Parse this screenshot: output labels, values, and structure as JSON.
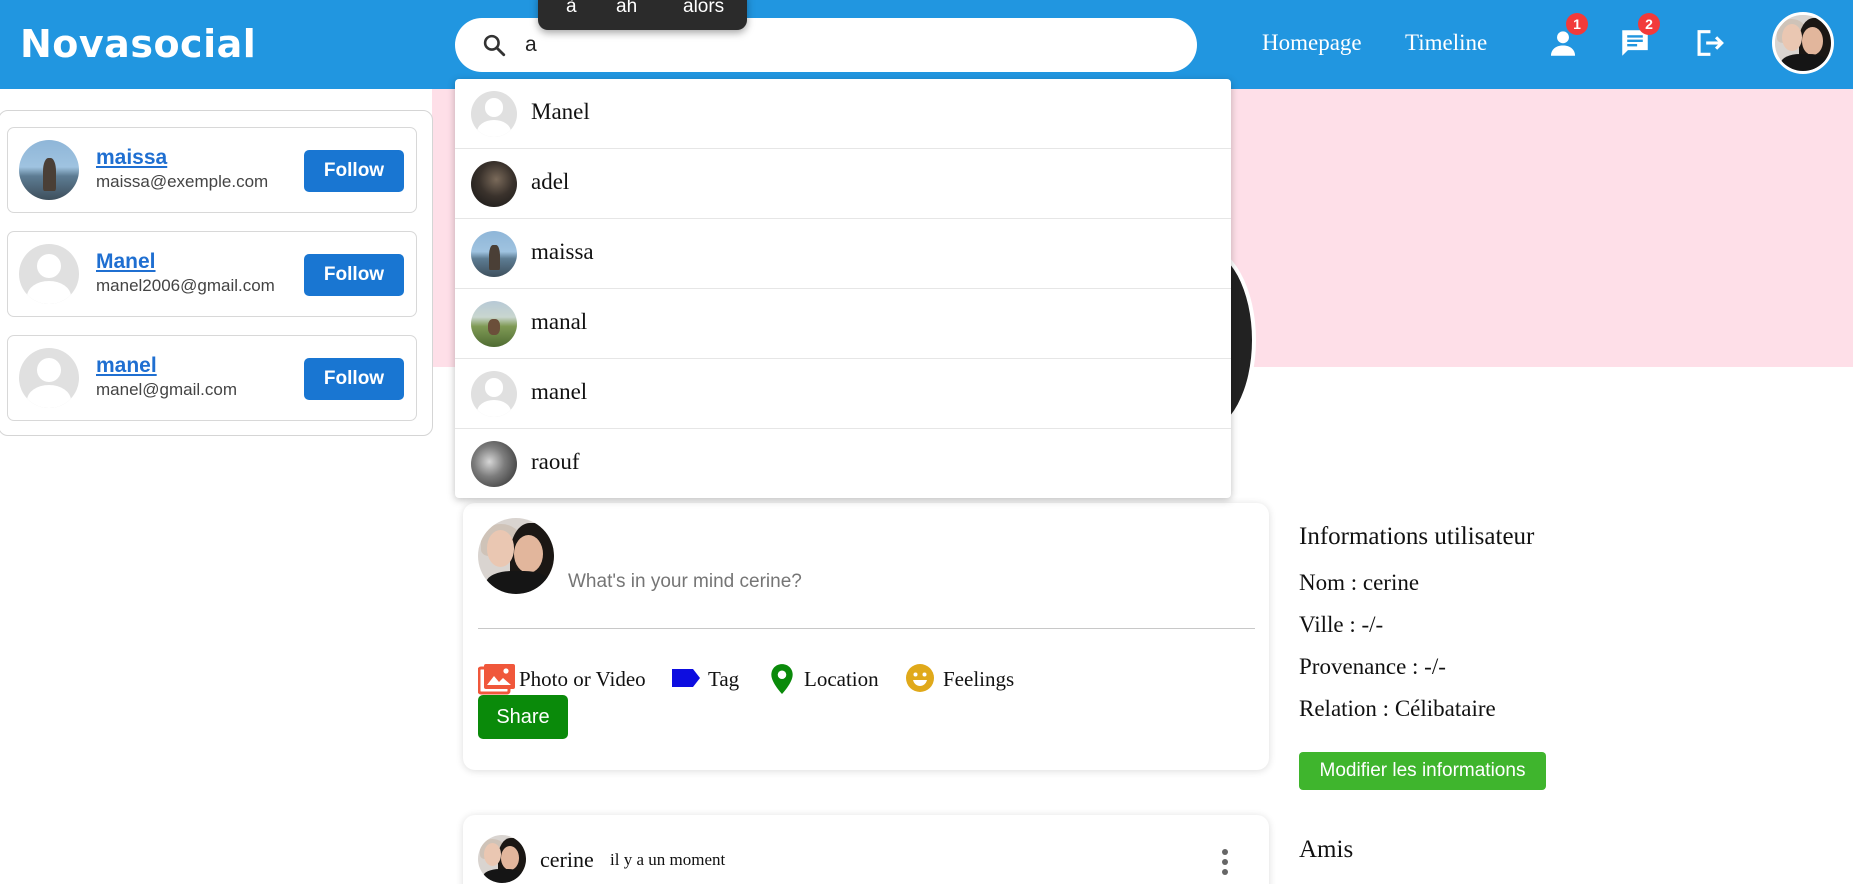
{
  "header": {
    "brand": "Novasocial",
    "search": {
      "value": "a",
      "icon": "search-icon"
    },
    "nav": {
      "homepage": "Homepage",
      "timeline": "Timeline"
    },
    "icons": {
      "friends": "person-icon",
      "messages": "chat-icon",
      "logout": "logout-icon"
    },
    "badges": {
      "friends": "1",
      "messages": "2"
    },
    "colors": {
      "bar": "#2196e0",
      "badge": "#f23a3a"
    }
  },
  "ime_suggestions": [
    "à",
    "ah",
    "alors"
  ],
  "search_results": [
    {
      "name": "Manel",
      "avatar": "placeholder"
    },
    {
      "name": "adel",
      "avatar": "photo-dark"
    },
    {
      "name": "maissa",
      "avatar": "photo-lake"
    },
    {
      "name": "manal",
      "avatar": "photo-green"
    },
    {
      "name": "manel",
      "avatar": "placeholder"
    },
    {
      "name": "raouf",
      "avatar": "photo-bw"
    }
  ],
  "suggestions": {
    "follow_label": "Follow",
    "users": [
      {
        "name": "maissa",
        "email": "maissa@exemple.com",
        "avatar": "photo-lake"
      },
      {
        "name": "Manel",
        "email": "manel2006@gmail.com",
        "avatar": "placeholder"
      },
      {
        "name": "manel",
        "email": "manel@gmail.com",
        "avatar": "placeholder"
      }
    ]
  },
  "composer": {
    "placeholder": "What's in your mind cerine?",
    "options": {
      "photo": "Photo or Video",
      "tag": "Tag",
      "location": "Location",
      "feelings": "Feelings"
    },
    "share_label": "Share",
    "colors": {
      "photo": "#f0573b",
      "tag": "#0d0de0",
      "location": "#0a8a0a",
      "feelings": "#e0a91a",
      "share": "#0a8a0a"
    }
  },
  "post": {
    "author": "cerine",
    "time": "il y a un moment"
  },
  "user_info": {
    "title": "Informations utilisateur",
    "nom": "Nom : cerine",
    "ville": "Ville : -/-",
    "provenance": "Provenance : -/-",
    "relation": "Relation : Célibataire",
    "edit_label": "Modifier les informations",
    "friends_title": "Amis"
  },
  "cover": {
    "color": "#fedfe8"
  }
}
